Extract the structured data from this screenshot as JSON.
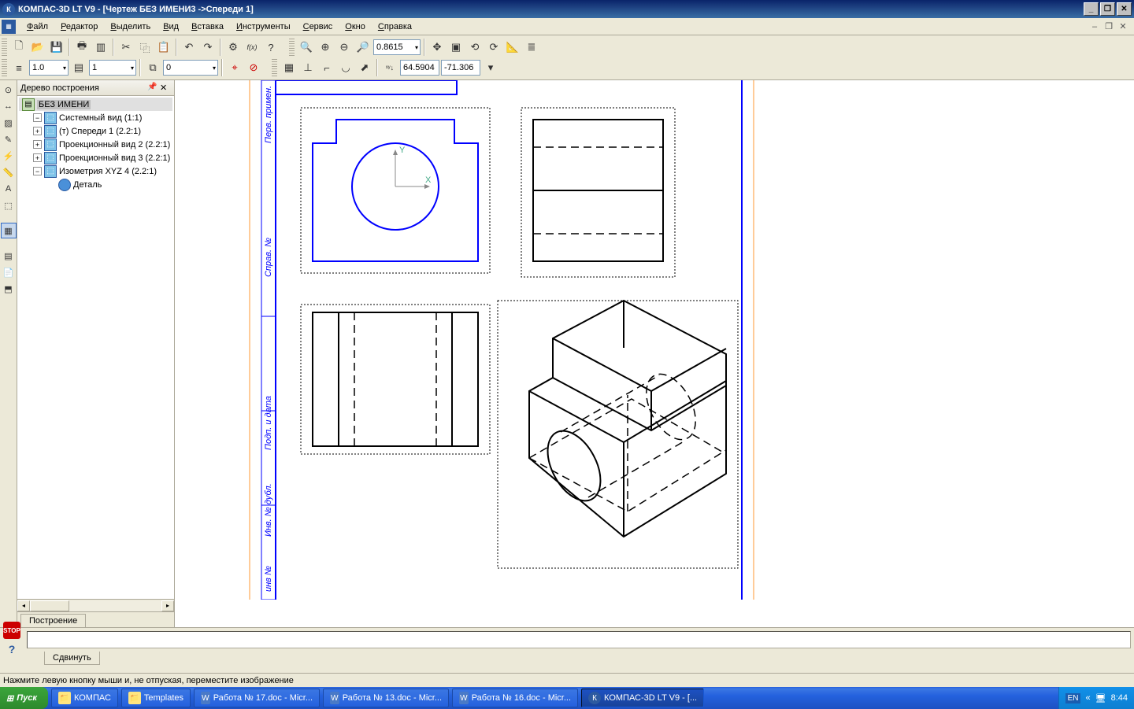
{
  "title": "КОМПАС-3D LT V9 - [Чертеж БЕЗ ИМЕНИ3 ->Спереди 1]",
  "menu": [
    "Файл",
    "Редактор",
    "Выделить",
    "Вид",
    "Вставка",
    "Инструменты",
    "Сервис",
    "Окно",
    "Справка"
  ],
  "toolbar": {
    "zoom": "0.8615",
    "lineweight": "1.0",
    "layer": "1",
    "linetype": "0",
    "coordX": "64.5904",
    "coordY": "-71.306"
  },
  "tree": {
    "title": "Дерево построения",
    "root": "БЕЗ ИМЕНИ",
    "items": [
      "Системный вид (1:1)",
      "(т) Спереди 1 (2.2:1)",
      "Проекционный вид 2 (2.2:1)",
      "Проекционный вид 3 (2.2:1)",
      "Изометрия XYZ 4 (2.2:1)"
    ],
    "detail": "Деталь"
  },
  "bottomTab": "Построение",
  "cmdTab": "Сдвинуть",
  "status": "Нажмите левую кнопку мыши и, не отпуская, переместите изображение",
  "taskbar": {
    "start": "Пуск",
    "items": [
      {
        "label": "КОМПАС",
        "icon": "folder"
      },
      {
        "label": "Templates",
        "icon": "folder"
      },
      {
        "label": "Работа № 17.doc - Micr...",
        "icon": "word"
      },
      {
        "label": "Работа № 13.doc - Micr...",
        "icon": "word"
      },
      {
        "label": "Работа № 16.doc - Micr...",
        "icon": "word"
      },
      {
        "label": "КОМПАС-3D LT V9 - [...",
        "icon": "k",
        "active": true
      }
    ],
    "lang": "EN",
    "time": "8:44"
  }
}
